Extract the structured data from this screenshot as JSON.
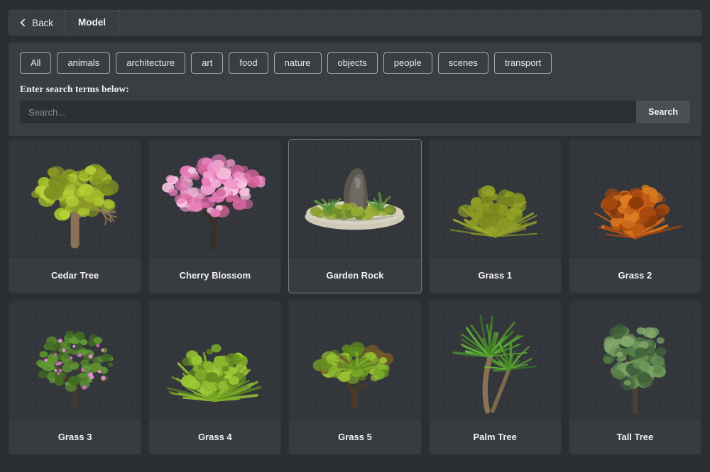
{
  "window": {
    "background_color": "#2b2e32",
    "panel_color": "#3a3d42"
  },
  "header": {
    "back_label": "Back",
    "back_icon": "chevron-left-icon",
    "title": "Model"
  },
  "filters": {
    "categories": [
      {
        "label": "All",
        "active": true
      },
      {
        "label": "animals",
        "active": false
      },
      {
        "label": "architecture",
        "active": false
      },
      {
        "label": "art",
        "active": false
      },
      {
        "label": "food",
        "active": false
      },
      {
        "label": "nature",
        "active": false
      },
      {
        "label": "objects",
        "active": false
      },
      {
        "label": "people",
        "active": false
      },
      {
        "label": "scenes",
        "active": false
      },
      {
        "label": "transport",
        "active": false
      }
    ]
  },
  "search": {
    "label": "Enter search terms below:",
    "placeholder": "Search...",
    "value": "",
    "button_label": "Search",
    "button_color": "#4b4f55"
  },
  "grid": {
    "columns": 5,
    "items": [
      {
        "name": "Cedar Tree",
        "art": "cedar",
        "selected": false
      },
      {
        "name": "Cherry Blossom",
        "art": "cherry",
        "selected": false
      },
      {
        "name": "Garden Rock",
        "art": "rock",
        "selected": true
      },
      {
        "name": "Grass 1",
        "art": "grass1",
        "selected": false
      },
      {
        "name": "Grass 2",
        "art": "grass2",
        "selected": false
      },
      {
        "name": "Grass 3",
        "art": "grass3",
        "selected": false
      },
      {
        "name": "Grass 4",
        "art": "grass4",
        "selected": false
      },
      {
        "name": "Grass 5",
        "art": "grass5",
        "selected": false
      },
      {
        "name": "Palm Tree",
        "art": "palm",
        "selected": false
      },
      {
        "name": "Tall Tree",
        "art": "tall",
        "selected": false
      }
    ]
  },
  "palette": {
    "leaf_yellow_green": "#a8c32a",
    "leaf_olive": "#8d9a24",
    "leaf_green": "#5f9a34",
    "leaf_dark_green": "#4a7a3e",
    "blossom_pink": "#e87cbb",
    "autumn_orange": "#c25a12",
    "bark_brown": "#8a7256",
    "bark_dark": "#3a2f26",
    "rock_gray": "#6e6a63",
    "sand": "#d8d2c2",
    "moss": "#9bb03a"
  }
}
